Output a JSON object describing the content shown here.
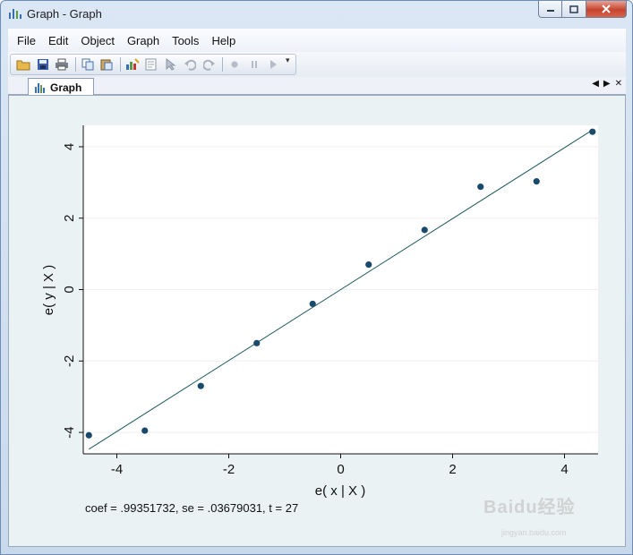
{
  "window": {
    "title": "Graph - Graph"
  },
  "menu": [
    "File",
    "Edit",
    "Object",
    "Graph",
    "Tools",
    "Help"
  ],
  "toolbar_icons": [
    "open-icon",
    "save-icon",
    "print-icon",
    "copy-icon",
    "paste-icon",
    "graph-editor-icon",
    "properties-icon",
    "pointer-icon",
    "undo-icon",
    "redo-icon",
    "record-icon",
    "pause-icon",
    "play-icon"
  ],
  "tab": {
    "label": "Graph"
  },
  "colors": {
    "marker": "#1a4a6b",
    "fit_line": "#1f5a5a",
    "plot_bg": "#ffffff",
    "outer_bg": "#eaf2f3"
  },
  "chart_data": {
    "type": "scatter",
    "xlabel": "e( x | X )",
    "ylabel": "e( y | X )",
    "xlim": [
      -4.6,
      4.6
    ],
    "ylim": [
      -4.6,
      4.6
    ],
    "xticks": [
      -4,
      -2,
      0,
      2,
      4
    ],
    "yticks": [
      -4,
      -2,
      0,
      2,
      4
    ],
    "grid": true,
    "points": [
      {
        "x": -4.5,
        "y": -4.08
      },
      {
        "x": -3.5,
        "y": -3.95
      },
      {
        "x": -2.5,
        "y": -2.7
      },
      {
        "x": -1.5,
        "y": -1.5
      },
      {
        "x": -0.5,
        "y": -0.4
      },
      {
        "x": 0.5,
        "y": 0.7
      },
      {
        "x": 1.5,
        "y": 1.67
      },
      {
        "x": 2.5,
        "y": 2.88
      },
      {
        "x": 3.5,
        "y": 3.03
      },
      {
        "x": 4.5,
        "y": 4.42
      }
    ],
    "fit_line": {
      "slope": 0.99351732,
      "intercept": 0
    },
    "note": "coef = .99351732, se = .03679031, t = 27"
  },
  "watermark": {
    "text": "Baidu经验",
    "url": "jingyan.baidu.com"
  }
}
